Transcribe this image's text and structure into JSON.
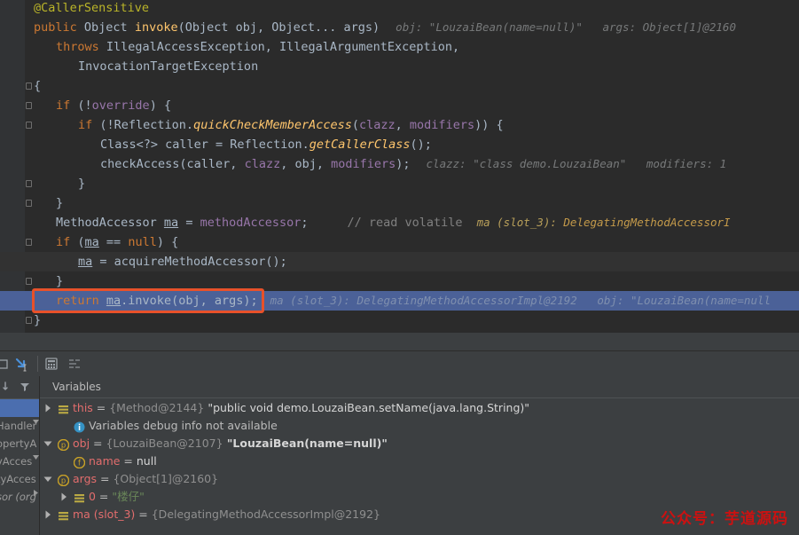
{
  "editor": {
    "language": "java",
    "theme_background": "#2b2b2b",
    "highlight_color": "#4b6198",
    "redbox_color": "#e8512a",
    "lines": [
      {
        "n": 1,
        "indent": 0,
        "tokens": [
          {
            "t": "@CallerSensitive",
            "c": "ann"
          }
        ]
      },
      {
        "n": 2,
        "indent": 0,
        "tokens": [
          {
            "t": "public ",
            "c": "kw"
          },
          {
            "t": "Object ",
            "c": "id"
          },
          {
            "t": "invoke",
            "c": "fn"
          },
          {
            "t": "(Object obj, Object... args)",
            "c": "id"
          }
        ],
        "hint": "obj: \"LouzaiBean(name=null)\"   args: Object[1]@2160"
      },
      {
        "n": 3,
        "indent": 1,
        "tokens": [
          {
            "t": "throws ",
            "c": "kw"
          },
          {
            "t": "IllegalAccessException, IllegalArgumentException,",
            "c": "id"
          }
        ]
      },
      {
        "n": 4,
        "indent": 2,
        "tokens": [
          {
            "t": "InvocationTargetException",
            "c": "id"
          }
        ]
      },
      {
        "n": 5,
        "indent": 0,
        "tokens": [
          {
            "t": "{",
            "c": "id"
          }
        ]
      },
      {
        "n": 6,
        "indent": 1,
        "tokens": [
          {
            "t": "if ",
            "c": "kw"
          },
          {
            "t": "(!",
            "c": "id"
          },
          {
            "t": "override",
            "c": "fld"
          },
          {
            "t": ") {",
            "c": "id"
          }
        ]
      },
      {
        "n": 7,
        "indent": 2,
        "tokens": [
          {
            "t": "if ",
            "c": "kw"
          },
          {
            "t": "(!Reflection.",
            "c": "id"
          },
          {
            "t": "quickCheckMemberAccess",
            "c": "fni"
          },
          {
            "t": "(",
            "c": "id"
          },
          {
            "t": "clazz",
            "c": "fld"
          },
          {
            "t": ", ",
            "c": "id"
          },
          {
            "t": "modifiers",
            "c": "fld"
          },
          {
            "t": ")) {",
            "c": "id"
          }
        ]
      },
      {
        "n": 8,
        "indent": 3,
        "tokens": [
          {
            "t": "Class<?> caller = Reflection.",
            "c": "id"
          },
          {
            "t": "getCallerClass",
            "c": "fni"
          },
          {
            "t": "();",
            "c": "id"
          }
        ]
      },
      {
        "n": 9,
        "indent": 3,
        "tokens": [
          {
            "t": "checkAccess",
            "c": "id"
          },
          {
            "t": "(caller, ",
            "c": "id"
          },
          {
            "t": "clazz",
            "c": "fld"
          },
          {
            "t": ", obj, ",
            "c": "id"
          },
          {
            "t": "modifiers",
            "c": "fld"
          },
          {
            "t": ");",
            "c": "id"
          }
        ],
        "hint": "clazz: \"class demo.LouzaiBean\"   modifiers: 1"
      },
      {
        "n": 10,
        "indent": 2,
        "tokens": [
          {
            "t": "}",
            "c": "id"
          }
        ]
      },
      {
        "n": 11,
        "indent": 1,
        "tokens": [
          {
            "t": "}",
            "c": "id"
          }
        ]
      },
      {
        "n": 12,
        "indent": 1,
        "tokens": [
          {
            "t": "MethodAccessor ",
            "c": "id"
          },
          {
            "t": "ma",
            "c": "fldu"
          },
          {
            "t": " = ",
            "c": "id"
          },
          {
            "t": "methodAccessor",
            "c": "fld"
          },
          {
            "t": ";",
            "c": "id"
          }
        ],
        "comment": "// read volatile",
        "hint_y": "ma (slot_3): ",
        "hint_o": "DelegatingMethodAccessorI"
      },
      {
        "n": 13,
        "indent": 1,
        "tokens": [
          {
            "t": "if ",
            "c": "kw"
          },
          {
            "t": "(",
            "c": "id"
          },
          {
            "t": "ma",
            "c": "fldu"
          },
          {
            "t": " == ",
            "c": "id"
          },
          {
            "t": "null",
            "c": "kw"
          },
          {
            "t": ") {",
            "c": "id"
          }
        ]
      },
      {
        "n": 14,
        "indent": 2,
        "tokens": [
          {
            "t": "ma",
            "c": "fldu"
          },
          {
            "t": " = acquireMethodAccessor();",
            "c": "id"
          }
        ],
        "dim": true
      },
      {
        "n": 15,
        "indent": 1,
        "tokens": [
          {
            "t": "}",
            "c": "id"
          }
        ]
      },
      {
        "n": 16,
        "indent": 1,
        "tokens": [
          {
            "t": "return ",
            "c": "kw"
          },
          {
            "t": "ma",
            "c": "fldu"
          },
          {
            "t": ".invoke(obj, args);",
            "c": "id"
          }
        ],
        "selected": true,
        "boxed": true,
        "hint_sel": "ma (slot_3): DelegatingMethodAccessorImpl@2192   obj: \"LouzaiBean(name=null"
      },
      {
        "n": 17,
        "indent": 0,
        "tokens": [
          {
            "t": "}",
            "c": "id"
          }
        ]
      }
    ]
  },
  "debug_panel": {
    "toolbar": {
      "icons": [
        {
          "name": "evaluate-expression-icon",
          "glyph": "calculator"
        },
        {
          "name": "settings-lines-icon",
          "glyph": "lines"
        }
      ],
      "left_icons": [
        {
          "name": "step-out-icon",
          "glyph": "step-out"
        },
        {
          "name": "run-to-cursor-icon",
          "glyph": "run-to-cursor"
        }
      ]
    },
    "frames": {
      "header": "",
      "sort_icon": "sort-icon",
      "filter_icon": "filter-icon",
      "rows": [
        {
          "label": "",
          "selected": true
        },
        {
          "label": "Handler"
        },
        {
          "label": "opertyA"
        },
        {
          "label": "yAcces"
        },
        {
          "label": "tyAcces"
        },
        {
          "label": "sor (org",
          "italic": true
        }
      ]
    },
    "variables": {
      "title": "Variables",
      "rows": [
        {
          "indent": 0,
          "expandable": true,
          "expanded": false,
          "icon": "value-list-icon",
          "icon_color": "#bbaa44",
          "name": "this",
          "eq": " = ",
          "ref": "{Method@2144}",
          "value": " \"public void demo.LouzaiBean.setName(java.lang.String)\"",
          "value_style": "plain"
        },
        {
          "indent": 1,
          "expandable": false,
          "icon": "info-icon",
          "icon_color": "#3592c4",
          "name": "",
          "eq": "",
          "ref": "",
          "value": "Variables debug info not available",
          "value_style": "info"
        },
        {
          "indent": 0,
          "expandable": true,
          "expanded": true,
          "icon": "parameter-icon",
          "icon_color": "#c9a227",
          "name": "obj",
          "eq": " = ",
          "ref": "{LouzaiBean@2107}",
          "value": " \"LouzaiBean(name=null)\"",
          "value_style": "strong"
        },
        {
          "indent": 1,
          "expandable": false,
          "icon": "field-icon",
          "icon_color": "#c9a227",
          "name": "name",
          "eq": " = ",
          "ref": "",
          "value": "null",
          "value_style": "plain"
        },
        {
          "indent": 0,
          "expandable": true,
          "expanded": true,
          "icon": "parameter-icon",
          "icon_color": "#c9a227",
          "name": "args",
          "eq": " = ",
          "ref": "{Object[1]@2160}",
          "value": "",
          "value_style": "plain"
        },
        {
          "indent": 1,
          "expandable": true,
          "expanded": false,
          "icon": "value-list-icon",
          "icon_color": "#bbaa44",
          "name": "0",
          "eq": " = ",
          "ref": "",
          "value": "\"楼仔\"",
          "value_style": "string"
        },
        {
          "indent": 0,
          "expandable": true,
          "expanded": false,
          "icon": "value-list-icon",
          "icon_color": "#bbaa44",
          "name": "ma (slot_3)",
          "eq": " = ",
          "ref": "{DelegatingMethodAccessorImpl@2192}",
          "value": "",
          "value_style": "plain"
        }
      ]
    }
  },
  "watermark": {
    "text": "公众号：芋道源码",
    "color": "#cc1111"
  }
}
